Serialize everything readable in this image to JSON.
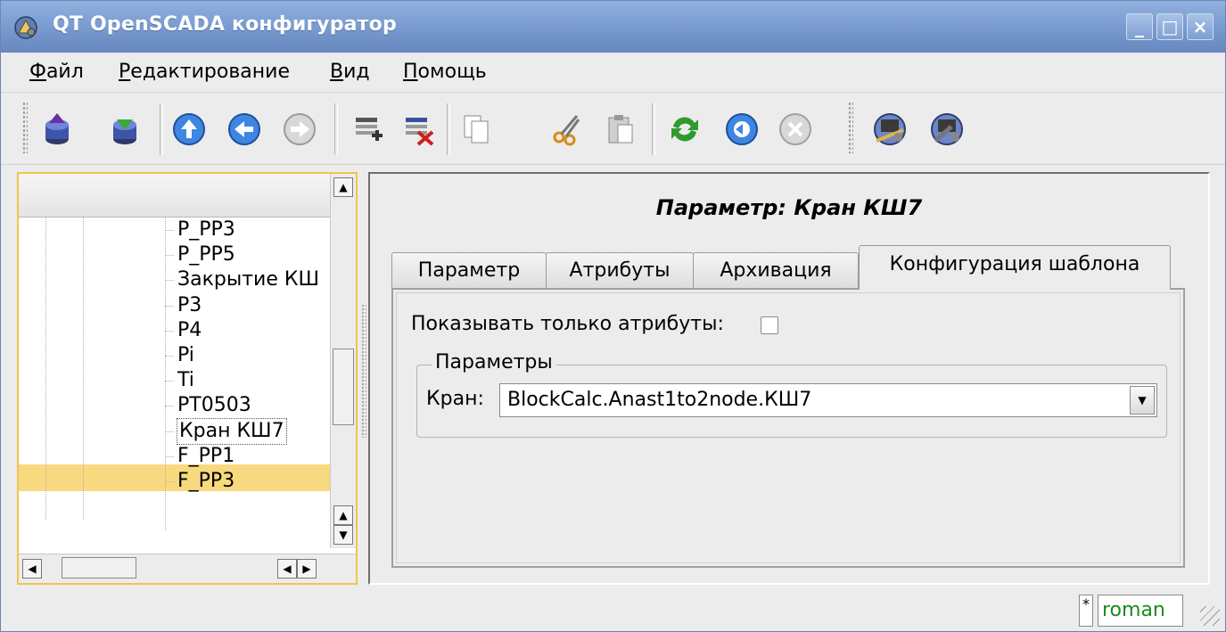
{
  "window": {
    "title": "QT OpenSCADA конфигуратор"
  },
  "menu": {
    "file": {
      "label": "Файл",
      "hotkey": "Ф",
      "rest": "айл"
    },
    "edit": {
      "label": "Редактирование",
      "hotkey": "Р",
      "rest": "едактирование"
    },
    "view": {
      "label": "Вид",
      "hotkey": "В",
      "rest": "ид"
    },
    "help": {
      "label": "Помощь",
      "hotkey": "П",
      "rest": "омощь"
    }
  },
  "toolbar": {
    "buttons": [
      "db-load-icon",
      "db-save-icon",
      "up-icon",
      "back-icon",
      "forward-icon",
      "add-item-icon",
      "delete-item-icon",
      "copy-icon",
      "cut-icon",
      "paste-icon",
      "refresh-icon",
      "start-icon",
      "stop-icon",
      "station-icon",
      "station-tools-icon"
    ]
  },
  "tree": {
    "nodes": [
      "P_PP3",
      "P_PP5",
      "Закрытие КШ",
      "P3",
      "P4",
      "Pi",
      "Ti",
      "PT0503",
      "Кран КШ7",
      "F_PP1",
      "F_PP3"
    ],
    "selected": "Кран КШ7"
  },
  "panel": {
    "title": "Параметр: Кран КШ7",
    "tabs": [
      "Параметр",
      "Атрибуты",
      "Архивация",
      "Конфигурация шаблона"
    ],
    "active_tab": "Конфигурация шаблона",
    "show_only_attributes_label": "Показывать только атрибуты:",
    "show_only_attributes_checked": false,
    "group_label": "Параметры",
    "crane_label": "Кран:",
    "crane_value": "BlockCalc.Anast1to2node.КШ7"
  },
  "status": {
    "modified": "*",
    "user": "roman"
  },
  "colors": {
    "titlebar": "#7597cc",
    "selection": "#f8d980",
    "user": "#1c8a1c"
  }
}
